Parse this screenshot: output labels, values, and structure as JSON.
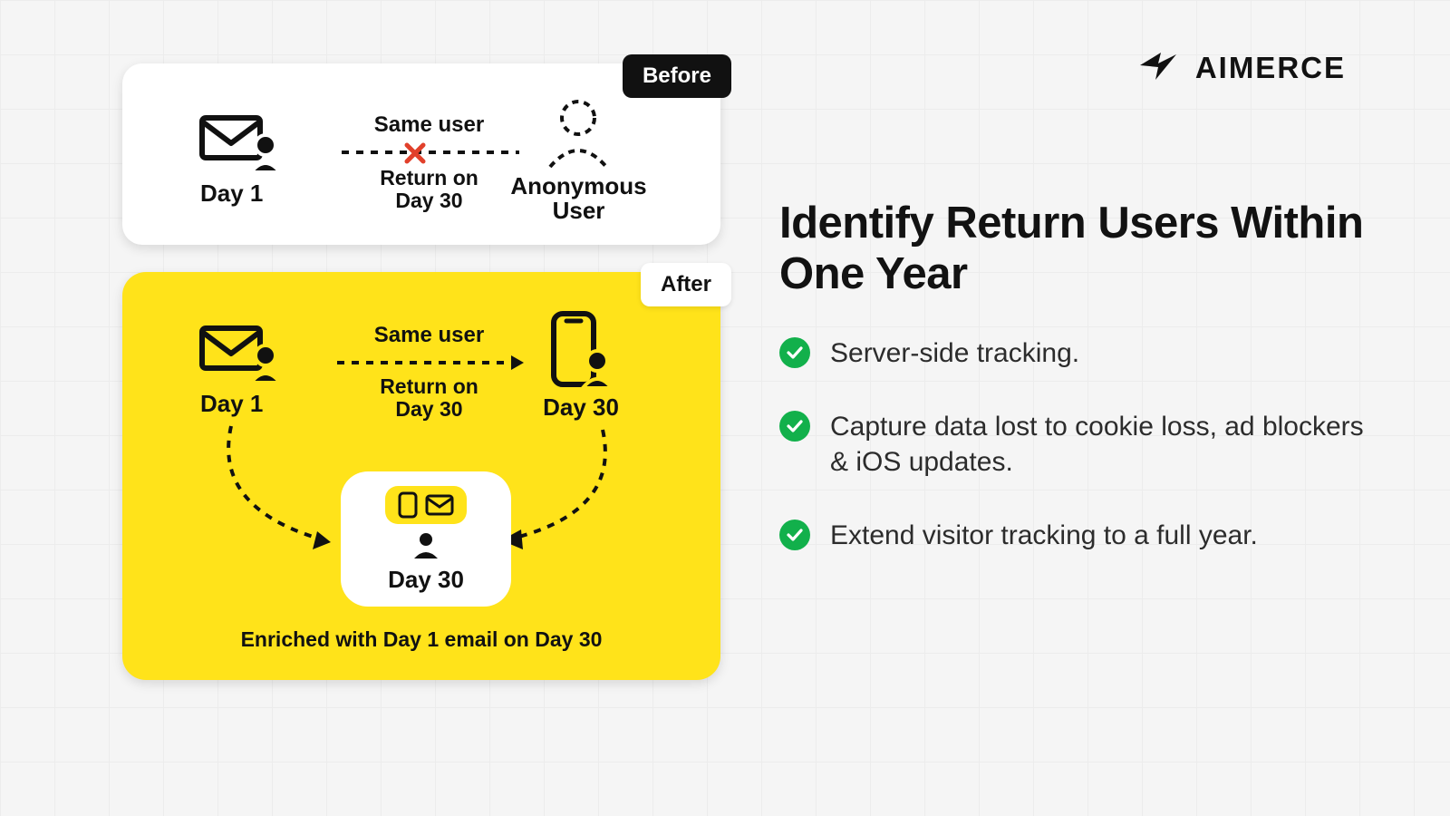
{
  "brand": "AIMERCE",
  "headline": "Identify Return Users Within One Year",
  "bullets": [
    "Server-side tracking.",
    "Capture data lost to cookie loss, ad blockers & iOS updates.",
    "Extend visitor tracking to a full year."
  ],
  "cards": {
    "before": {
      "tag": "Before",
      "left_label": "Day 1",
      "flow_top": "Same user",
      "flow_bot_line1": "Return on",
      "flow_bot_line2": "Day 30",
      "right_label_line1": "Anonymous",
      "right_label_line2": "User"
    },
    "after": {
      "tag": "After",
      "left_label": "Day 1",
      "flow_top": "Same user",
      "flow_bot_line1": "Return on",
      "flow_bot_line2": "Day 30",
      "right_label": "Day 30",
      "merge_label": "Day 30",
      "footer": "Enriched with Day 1 email on Day 30"
    }
  }
}
